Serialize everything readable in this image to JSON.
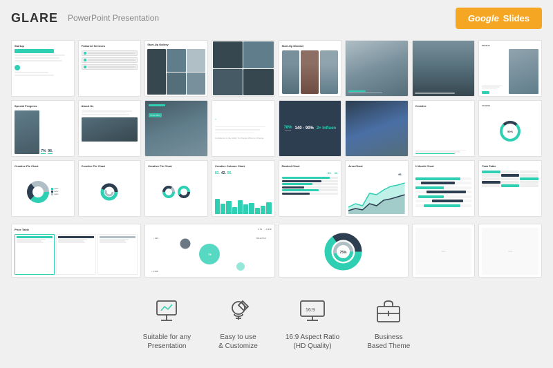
{
  "header": {
    "brand": "GLARE",
    "subtitle": "PowerPoint Presentation",
    "badge_text": "Google Slides"
  },
  "features": [
    {
      "id": "feature-presentation",
      "icon": "presentation-icon",
      "label": "Suitable for any\nPresentation"
    },
    {
      "id": "feature-customize",
      "icon": "customize-icon",
      "label": "Easy to use\n& Customize"
    },
    {
      "id": "feature-hd",
      "icon": "monitor-icon",
      "label": "16:9 Aspect Ratio\n(HD Quality)"
    },
    {
      "id": "feature-business",
      "icon": "briefcase-icon",
      "label": "Business\nBased Theme"
    }
  ],
  "slides": {
    "rows": 3,
    "cols": 8
  },
  "accent_color": "#2ecfb3",
  "dark_color": "#2c3e50"
}
